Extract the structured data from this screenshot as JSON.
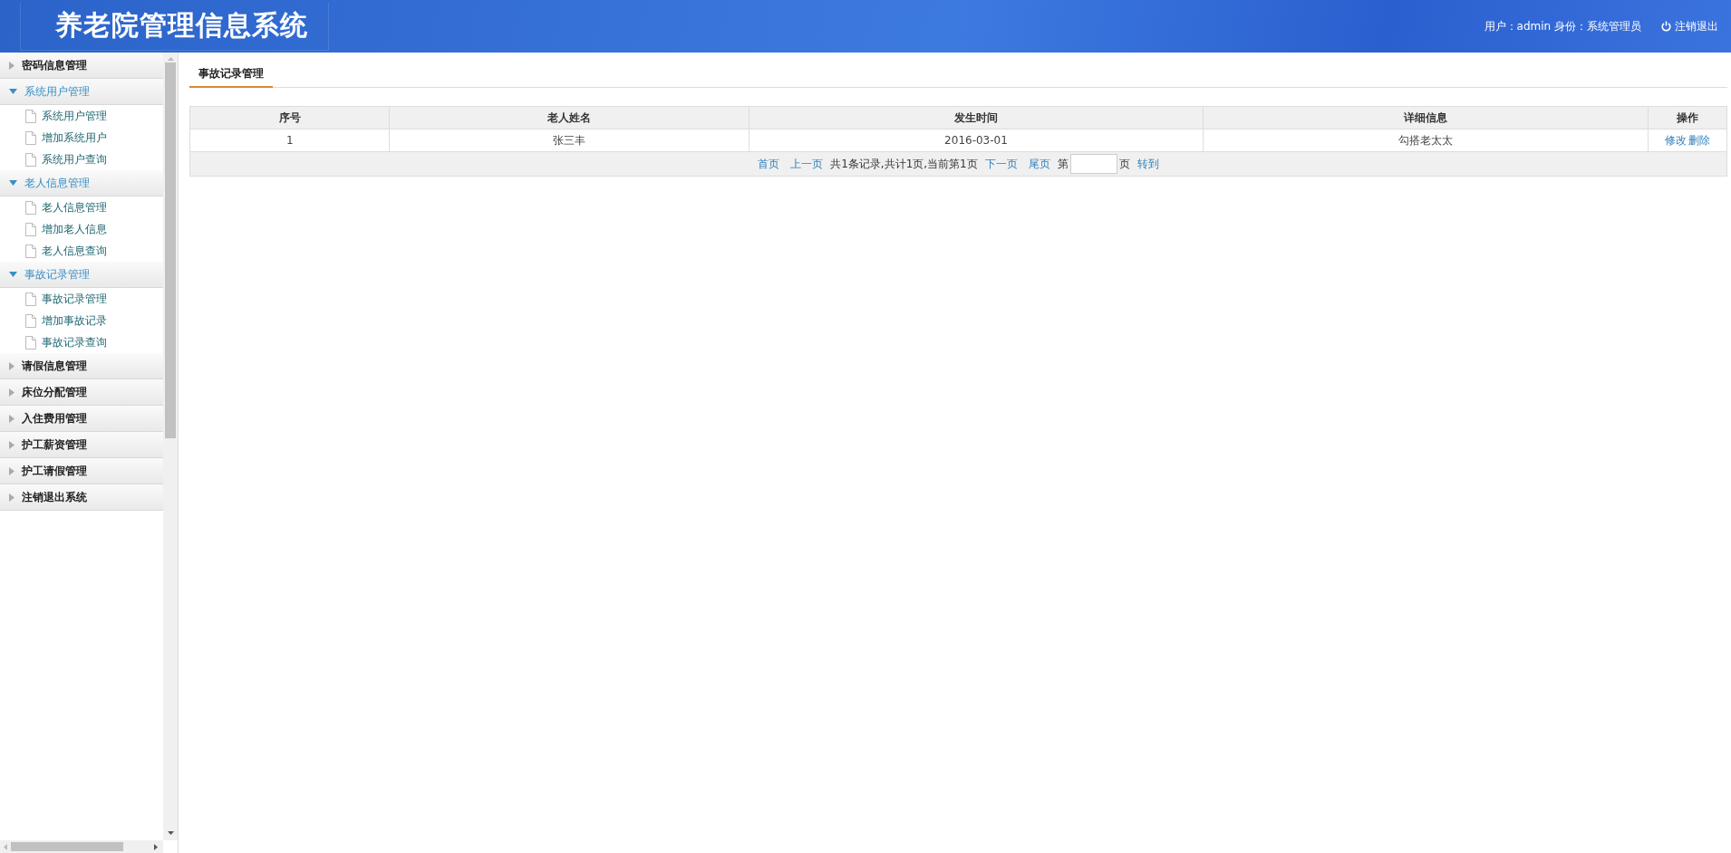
{
  "header": {
    "title": "养老院管理信息系统",
    "user_info": "用户：admin 身份：系统管理员",
    "logout": "注销退出"
  },
  "sidebar": {
    "groups": [
      {
        "label": "密码信息管理",
        "expanded": false
      },
      {
        "label": "系统用户管理",
        "expanded": true,
        "items": [
          "系统用户管理",
          "增加系统用户",
          "系统用户查询"
        ]
      },
      {
        "label": "老人信息管理",
        "expanded": true,
        "items": [
          "老人信息管理",
          "增加老人信息",
          "老人信息查询"
        ]
      },
      {
        "label": "事故记录管理",
        "expanded": true,
        "items": [
          "事故记录管理",
          "增加事故记录",
          "事故记录查询"
        ]
      },
      {
        "label": "请假信息管理",
        "expanded": false
      },
      {
        "label": "床位分配管理",
        "expanded": false
      },
      {
        "label": "入住费用管理",
        "expanded": false
      },
      {
        "label": "护工薪资管理",
        "expanded": false
      },
      {
        "label": "护工请假管理",
        "expanded": false
      },
      {
        "label": "注销退出系统",
        "expanded": false
      }
    ]
  },
  "tabs": [
    {
      "label": "事故记录管理",
      "selected": true
    }
  ],
  "table": {
    "columns": [
      "序号",
      "老人姓名",
      "发生时间",
      "详细信息",
      "操作"
    ],
    "rows": [
      {
        "cells": [
          "1",
          "张三丰",
          "2016-03-01",
          "勾搭老太太"
        ],
        "actions": [
          "修改",
          "删除"
        ]
      }
    ]
  },
  "pager": [
    {
      "kind": "link",
      "text": "首页"
    },
    {
      "kind": "link",
      "text": "上一页"
    },
    {
      "kind": "text",
      "text": "共1条记录,共计1页,当前第1页"
    },
    {
      "kind": "link",
      "text": "下一页"
    },
    {
      "kind": "link",
      "text": "尾页"
    },
    {
      "kind": "text",
      "text": "第"
    },
    {
      "kind": "input"
    },
    {
      "kind": "text",
      "text": "页"
    },
    {
      "kind": "link",
      "text": "转到"
    }
  ]
}
